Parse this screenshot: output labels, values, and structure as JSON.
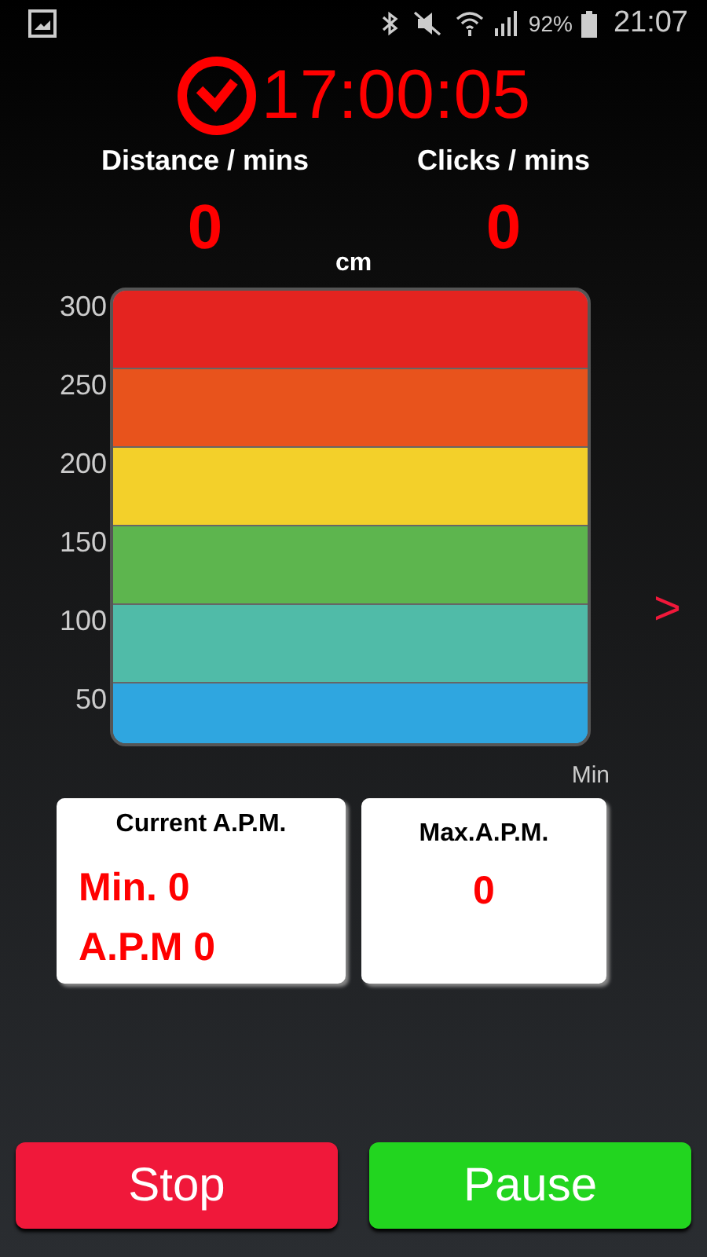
{
  "status_bar": {
    "battery": "92%",
    "time": "21:07"
  },
  "timer": "17:00:05",
  "stats": [
    {
      "label": "Distance / mins",
      "value": "0"
    },
    {
      "label": "Clicks / mins",
      "value": "0"
    }
  ],
  "chart": {
    "unit": "cm",
    "x_unit": "Min",
    "next": ">",
    "bands": [
      {
        "tick": "300",
        "color": "#e42420"
      },
      {
        "tick": "250",
        "color": "#e8531c"
      },
      {
        "tick": "200",
        "color": "#f3d02a"
      },
      {
        "tick": "150",
        "color": "#5db54e"
      },
      {
        "tick": "100",
        "color": "#50bba8"
      },
      {
        "tick": "50",
        "color": "#2fa6e0"
      }
    ]
  },
  "cards": [
    {
      "title": "Current A.P.M.",
      "lines": [
        "Min. 0",
        "A.P.M 0"
      ]
    },
    {
      "title": "Max.A.P.M.",
      "lines": [
        "0"
      ]
    }
  ],
  "buttons": [
    {
      "label": "Stop",
      "kind": "stop"
    },
    {
      "label": "Pause",
      "kind": "pause"
    }
  ]
}
